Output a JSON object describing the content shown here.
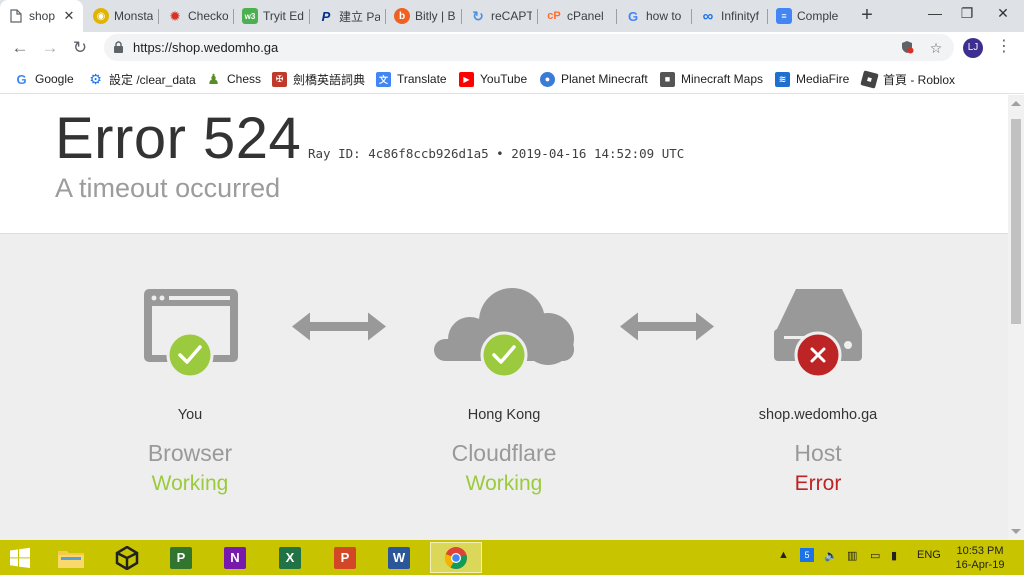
{
  "browser": {
    "tabs": [
      {
        "title": "shop",
        "icon": "page-icon",
        "color": "#5f6368",
        "active": true
      },
      {
        "title": "Monsta",
        "icon": "monsta-icon",
        "color": "#e0b400"
      },
      {
        "title": "Checko",
        "icon": "checkout-icon",
        "color": "#d93025"
      },
      {
        "title": "Tryit Ed",
        "icon": "w3schools-icon",
        "color": "#4caf50"
      },
      {
        "title": "建立 Pa",
        "icon": "paypal-icon",
        "color": "#003087"
      },
      {
        "title": "Bitly | B",
        "icon": "bitly-icon",
        "color": "#ee6123"
      },
      {
        "title": "reCAPT",
        "icon": "recaptcha-icon",
        "color": "#4a90e2"
      },
      {
        "title": "cPanel",
        "icon": "cpanel-icon",
        "color": "#ff6c2c"
      },
      {
        "title": "how to",
        "icon": "google-icon",
        "color": "#4285f4"
      },
      {
        "title": "Infinityf",
        "icon": "infinity-icon",
        "color": "#1a73e8"
      },
      {
        "title": "Comple",
        "icon": "docs-icon",
        "color": "#4285f4"
      }
    ],
    "new_tab_label": "+",
    "url": "https://shop.wedomho.ga",
    "profile_initials": "LJ",
    "bookmarks": [
      {
        "label": "Google",
        "icon": "google-icon",
        "color": "#4285f4"
      },
      {
        "label": "設定 /clear_data",
        "icon": "gear-icon",
        "color": "#1a73e8"
      },
      {
        "label": "Chess",
        "icon": "chess-pawn-icon",
        "color": "#5b8c2a"
      },
      {
        "label": "劍橋英語詞典",
        "icon": "cambridge-icon",
        "color": "#c0392b"
      },
      {
        "label": "Translate",
        "icon": "translate-icon",
        "color": "#4285f4"
      },
      {
        "label": "YouTube",
        "icon": "youtube-icon",
        "color": "#ff0000"
      },
      {
        "label": "Planet Minecraft",
        "icon": "planet-icon",
        "color": "#3a7bd5"
      },
      {
        "label": "Minecraft Maps",
        "icon": "cube-icon",
        "color": "#555555"
      },
      {
        "label": "MediaFire",
        "icon": "mediafire-icon",
        "color": "#1f6fd1"
      },
      {
        "label": "首頁 - Roblox",
        "icon": "roblox-icon",
        "color": "#444444"
      }
    ]
  },
  "error_page": {
    "code": "Error 524",
    "ray_id": "Ray ID: 4c86f8ccb926d1a5 • 2019-04-16 14:52:09 UTC",
    "message": "A timeout occurred",
    "columns": [
      {
        "location": "You",
        "name": "Browser",
        "status": "Working",
        "state": "ok",
        "icon": "browser-window-icon"
      },
      {
        "location": "Hong Kong",
        "name": "Cloudflare",
        "status": "Working",
        "state": "ok",
        "icon": "cloud-icon"
      },
      {
        "location": "shop.wedomho.ga",
        "name": "Host",
        "status": "Error",
        "state": "error",
        "icon": "server-icon"
      }
    ],
    "colors": {
      "ok": "#9bca3e",
      "error": "#bd2426",
      "icon_gray": "#999999"
    }
  },
  "taskbar": {
    "apps": [
      {
        "name": "file-explorer-icon"
      },
      {
        "name": "unity-icon"
      },
      {
        "name": "project-icon",
        "label": "P",
        "color": "#31752f"
      },
      {
        "name": "onenote-icon",
        "label": "N",
        "color": "#7719aa"
      },
      {
        "name": "excel-icon",
        "label": "X",
        "color": "#217346"
      },
      {
        "name": "powerpoint-icon",
        "label": "P",
        "color": "#d24726"
      },
      {
        "name": "word-icon",
        "label": "W",
        "color": "#2b579a"
      },
      {
        "name": "chrome-icon",
        "active": true
      }
    ],
    "language": "ENG",
    "time": "10:53 PM",
    "date": "16-Apr-19"
  }
}
